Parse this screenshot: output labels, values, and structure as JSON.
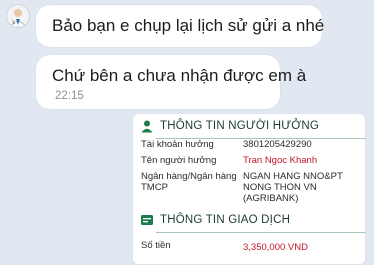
{
  "messages": [
    {
      "text": "Bảo bạn e chụp lại lịch sử gửi a nhé"
    },
    {
      "text": "Chứ bên a chưa nhận được em à",
      "time": "22:15"
    }
  ],
  "receipt": {
    "recipient_section_title": "THÔNG TIN NGƯỜI HƯỞNG",
    "account_label": "Tài khoản hưởng",
    "account_value": "3801205429290",
    "name_label": "Tên người hưởng",
    "name_value": "Tran Ngoc Khanh",
    "bank_label_1": "Ngân hàng/Ngân hàng",
    "bank_label_2": "TMCP",
    "bank_value_1": "NGAN HANG NNO&PT",
    "bank_value_2": "NONG THON VN",
    "bank_value_3": "(AGRIBANK)",
    "transaction_section_title": "THÔNG TIN GIAO DỊCH",
    "amount_label": "Số tiền",
    "amount_value": "3,350,000 VND"
  },
  "colors": {
    "background": "#e2e8f1",
    "bubble": "#ffffff",
    "accent_green": "#1e7b4e",
    "amount_red": "#c4162a"
  },
  "icons": [
    "doctor-avatar",
    "person-icon",
    "transfer-icon"
  ]
}
